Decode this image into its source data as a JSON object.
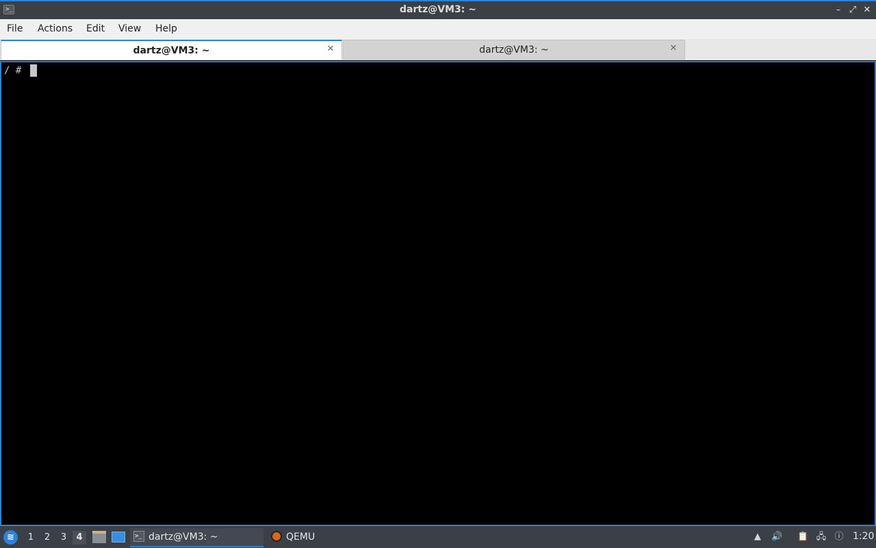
{
  "window": {
    "title": "dartz@VM3: ~",
    "icon": "terminal-icon",
    "buttons": {
      "minimize": "–",
      "maximize": "⤢",
      "close": "✕"
    }
  },
  "menubar": {
    "items": [
      "File",
      "Actions",
      "Edit",
      "View",
      "Help"
    ]
  },
  "tabs": [
    {
      "label": "dartz@VM3: ~",
      "active": true,
      "close": "✕"
    },
    {
      "label": "dartz@VM3: ~",
      "active": false,
      "close": "✕"
    }
  ],
  "terminal": {
    "prompt": "/ # "
  },
  "taskbar": {
    "start_icon": "lxqt-start-icon",
    "desktops": [
      "1",
      "2",
      "3",
      "4"
    ],
    "active_desktop": "4",
    "tasks": [
      {
        "label": "dartz@VM3: ~",
        "icon": "terminal-icon",
        "active": true
      },
      {
        "label": "QEMU",
        "icon": "qemu-icon",
        "active": false
      }
    ],
    "clock": "1:20"
  },
  "colors": {
    "accent": "#2a82da",
    "titlebar_bg": "#3b3f46",
    "terminal_bg": "#000000",
    "terminal_fg": "#c8c8c8"
  }
}
